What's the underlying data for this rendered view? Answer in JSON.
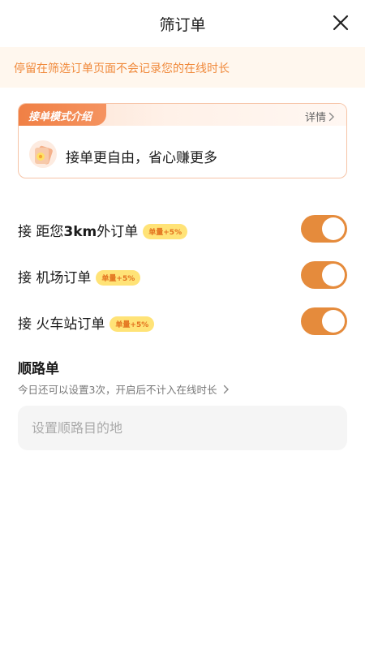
{
  "header": {
    "title": "筛订单",
    "close_icon": "close-icon"
  },
  "notice": {
    "text": "停留在筛选订单页面不会记录您的在线时长"
  },
  "intro_card": {
    "tag": "接单模式介绍",
    "detail": "详情",
    "text": "接单更自由，省心赚更多",
    "icon": "order-mode-icon"
  },
  "options": [
    {
      "label_prefix": "接 距您",
      "label_bold": "3km",
      "label_suffix": "外订单",
      "badge": "单量+5%",
      "enabled": true
    },
    {
      "label_prefix": "接 机场订单",
      "badge": "单量+5%",
      "enabled": true
    },
    {
      "label_prefix": "接 火车站订单",
      "badge": "单量+5%",
      "enabled": true
    }
  ],
  "route": {
    "title": "顺路单",
    "subtitle": "今日还可以设置3次，开启后不计入在线时长",
    "placeholder": "设置顺路目的地"
  },
  "colors": {
    "accent": "#e58b3c",
    "notice_text": "#f08a3c",
    "badge_bg": "#ffe377"
  }
}
